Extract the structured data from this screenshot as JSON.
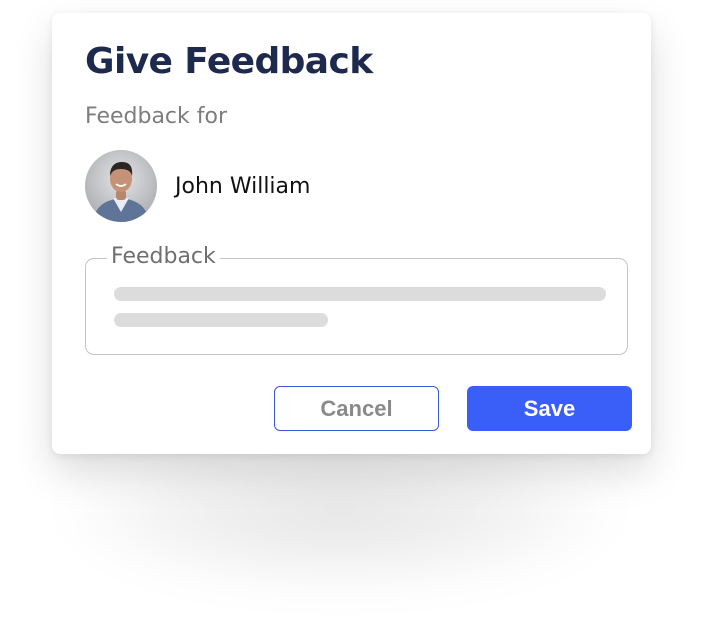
{
  "dialog": {
    "title": "Give Feedback",
    "subtitle": "Feedback for"
  },
  "recipient": {
    "name": "John William",
    "avatar_icon": "user-photo-avatar"
  },
  "feedback_field": {
    "label": "Feedback",
    "value_placeholder_lines": 2
  },
  "actions": {
    "cancel_label": "Cancel",
    "save_label": "Save"
  },
  "colors": {
    "title": "#1d2a4d",
    "primary": "#3a5ef8",
    "cancel_border": "#3a5bd9",
    "muted_text": "#7d7d7d",
    "skeleton": "#dcdcdc"
  }
}
